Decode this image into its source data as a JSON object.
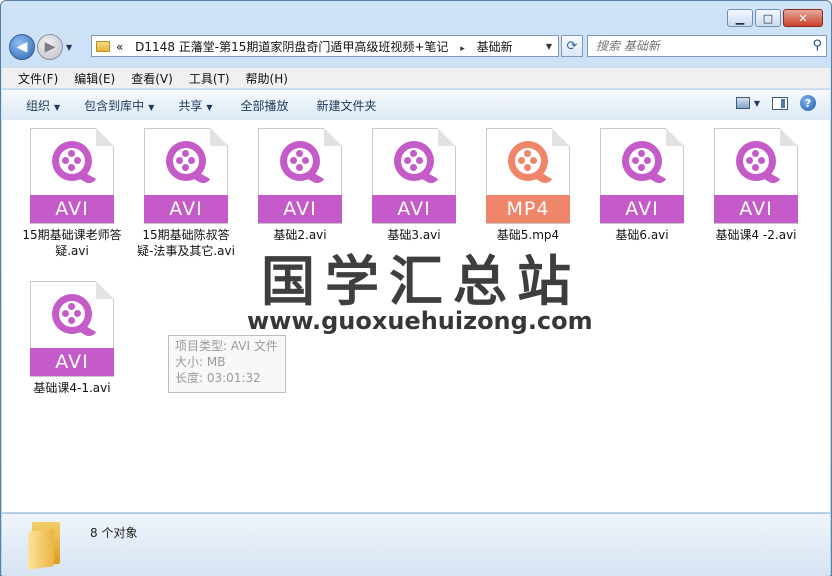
{
  "window": {
    "min_label": "▁",
    "max_label": "□",
    "close_label": "✕"
  },
  "address": {
    "overflow_label": "«",
    "path_part1": "D1148 正藩堂-第15期道家阴盘奇门遁甲高级班视频+笔记",
    "separator": "▸",
    "path_part2": "基础新",
    "search_placeholder": "搜索 基础新"
  },
  "menu": [
    "文件(F)",
    "编辑(E)",
    "查看(V)",
    "工具(T)",
    "帮助(H)"
  ],
  "toolbar": {
    "organize": "组织",
    "include_in_library": "包含到库中",
    "share": "共享",
    "play_all": "全部播放",
    "new_folder": "新建文件夹"
  },
  "files": [
    {
      "name": "15期基础课老师答疑.avi",
      "ext": "AVI",
      "type": "avi"
    },
    {
      "name": "15期基础陈叔答疑-法事及其它.avi",
      "ext": "AVI",
      "type": "avi"
    },
    {
      "name": "基础2.avi",
      "ext": "AVI",
      "type": "avi"
    },
    {
      "name": "基础3.avi",
      "ext": "AVI",
      "type": "avi"
    },
    {
      "name": "基础5.mp4",
      "ext": "MP4",
      "type": "mp4"
    },
    {
      "name": "基础6.avi",
      "ext": "AVI",
      "type": "avi"
    },
    {
      "name": "基础课4 -2.avi",
      "ext": "AVI",
      "type": "avi"
    },
    {
      "name": "基础课4-1.avi",
      "ext": "AVI",
      "type": "avi"
    }
  ],
  "tooltip": {
    "line1": "项目类型: AVI 文件",
    "line2": "大小: MB",
    "line3": "长度: 03:01:32"
  },
  "watermark": {
    "text": "国学汇总站",
    "url": "www.guoxuehuizong.com"
  },
  "status": {
    "count_text": "8 个对象"
  },
  "colors": {
    "avi": "#c45bc8",
    "mp4": "#ef866a"
  }
}
